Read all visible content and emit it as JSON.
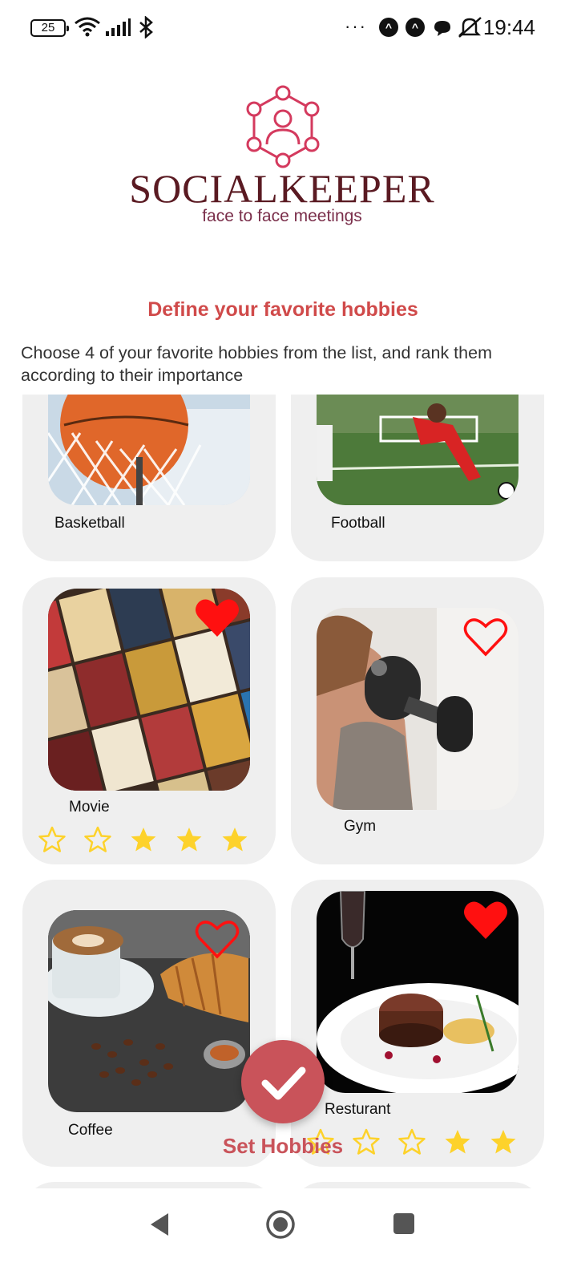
{
  "status_bar": {
    "battery": "25",
    "time": "19:44",
    "dots": "···"
  },
  "brand": {
    "name": "SOCIALKEEPER",
    "tagline": "face to face meetings"
  },
  "page": {
    "title": "Define your favorite hobbies",
    "instructions": "Choose 4 of your favorite hobbies from the list, and rank them according to their importance"
  },
  "hobbies": [
    {
      "label": "Basketball",
      "favorite": false,
      "rating": null
    },
    {
      "label": "Football",
      "favorite": false,
      "rating": null
    },
    {
      "label": "Movie",
      "favorite": true,
      "rating": 3
    },
    {
      "label": "Gym",
      "favorite": false,
      "rating": null
    },
    {
      "label": "Coffee",
      "favorite": false,
      "rating": null
    },
    {
      "label": "Resturant",
      "favorite": true,
      "rating": 2
    }
  ],
  "action": {
    "label": "Set Hobbies"
  },
  "colors": {
    "accent": "#c9535a",
    "title": "#d04a4a",
    "heart": "#ff0000",
    "star": "#fdd22b",
    "card_bg": "#efefef"
  }
}
